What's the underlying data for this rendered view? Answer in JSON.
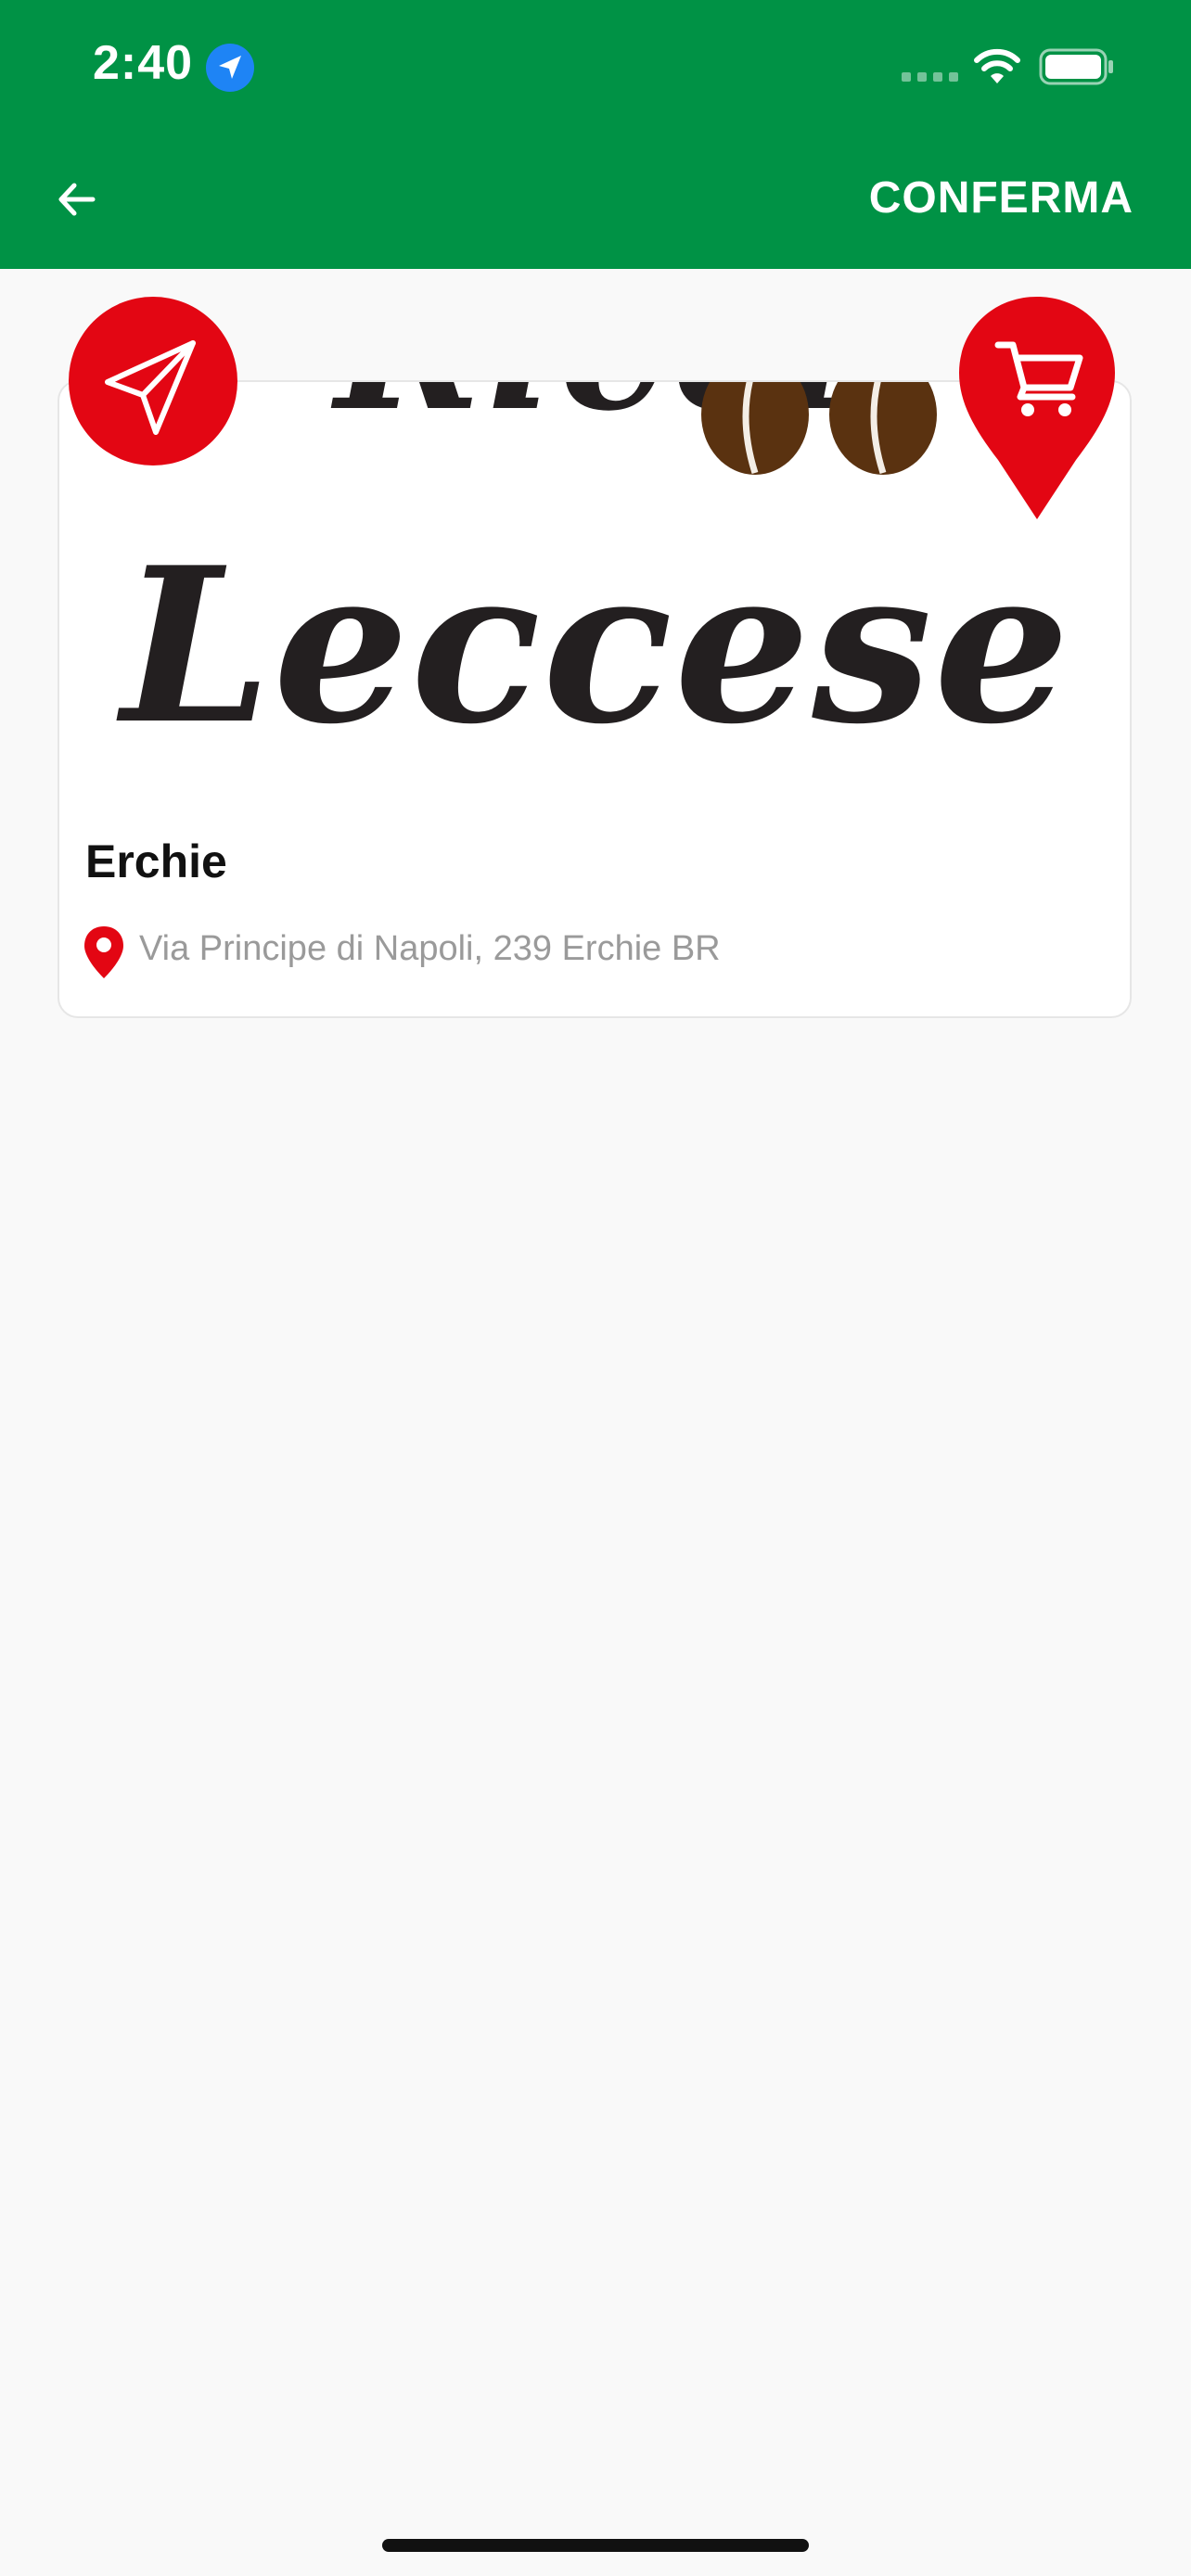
{
  "status_bar": {
    "time": "2:40"
  },
  "header": {
    "confirm_label": "CONFERMA",
    "back_icon": "arrow-left-icon"
  },
  "store": {
    "logo_line1": "Ricci",
    "logo_line2": "Leccese",
    "name": "Erchie",
    "address": "Via Principe di Napoli, 239 Erchie BR"
  },
  "colors": {
    "header_green": "#009245",
    "accent_red": "#e30613",
    "bean_brown": "#5a3210"
  }
}
